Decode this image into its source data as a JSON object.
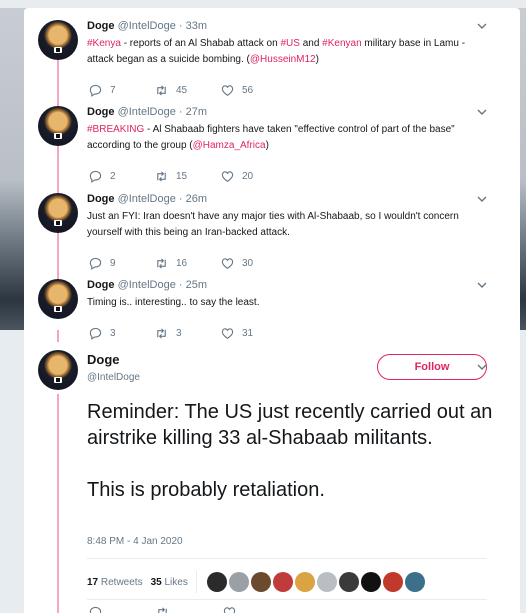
{
  "tweets": [
    {
      "name": "Doge",
      "handle": "@IntelDoge",
      "sep": " · ",
      "time": "33m",
      "body": [
        {
          "t": "#Kenya",
          "tag": true
        },
        {
          "t": " - reports of an Al Shabab attack on "
        },
        {
          "t": "#US",
          "tag": true
        },
        {
          "t": " and "
        },
        {
          "t": "#Kenyan",
          "tag": true
        },
        {
          "t": " military base in Lamu - attack began as a suicide bombing. ("
        },
        {
          "t": "@HusseinM12",
          "tag": true
        },
        {
          "t": ")"
        }
      ],
      "replies": "7",
      "retweets": "45",
      "likes": "56"
    },
    {
      "name": "Doge",
      "handle": "@IntelDoge",
      "sep": " · ",
      "time": "27m",
      "body": [
        {
          "t": "#BREAKING",
          "tag": true
        },
        {
          "t": " - Al Shabaab fighters have taken \"effective control of part of the base\" according to the group ("
        },
        {
          "t": "@Hamza_Africa",
          "tag": true
        },
        {
          "t": ")"
        }
      ],
      "replies": "2",
      "retweets": "15",
      "likes": "20"
    },
    {
      "name": "Doge",
      "handle": "@IntelDoge",
      "sep": " · ",
      "time": "26m",
      "body": [
        {
          "t": "Just an FYI: Iran doesn't have any major ties with Al-Shabaab, so I wouldn't concern yourself with this being an Iran-backed attack."
        }
      ],
      "replies": "9",
      "retweets": "16",
      "likes": "30"
    },
    {
      "name": "Doge",
      "handle": "@IntelDoge",
      "sep": " · ",
      "time": "25m",
      "body": [
        {
          "t": "Timing is.. interesting.. to say the least."
        }
      ],
      "replies": "3",
      "retweets": "3",
      "likes": "31"
    }
  ],
  "main": {
    "name": "Doge",
    "handle": "@IntelDoge",
    "follow_label": "Follow",
    "paragraph1": "Reminder: The US just recently carried out an airstrike killing 33 al-Shabaab militants.",
    "paragraph2": "This is probably retaliation.",
    "timestamp": "8:48 PM - 4 Jan 2020",
    "retweet_count": "17",
    "retweet_label": " Retweets",
    "like_count": "35",
    "like_label": " Likes"
  },
  "colors": {
    "accent": "#e0245e",
    "thread": "#f4a6c6",
    "text": "#14171a",
    "muted": "#657786"
  },
  "liker_colors": [
    "#2b2b2b",
    "#9aa0a6",
    "#6b4a2e",
    "#c23b3b",
    "#d9a441",
    "#b8bec4",
    "#3a3a3a",
    "#111111",
    "#c0392b",
    "#3b6f8a"
  ]
}
